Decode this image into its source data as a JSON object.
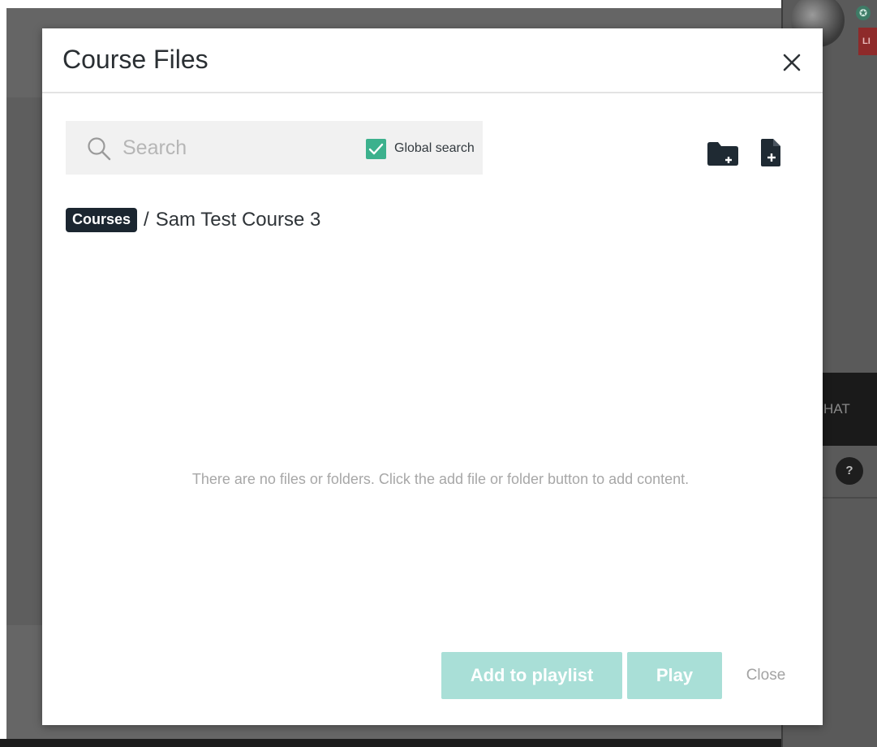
{
  "background": {
    "live_badge": "LI",
    "chat_tab": "HAT",
    "help_icon": "?"
  },
  "modal": {
    "title": "Course Files",
    "close_icon": "close-icon"
  },
  "search": {
    "placeholder": "Search",
    "value": "",
    "global_search_label": "Global search",
    "global_search_checked": true
  },
  "toolbar": {
    "new_folder_icon": "folder-plus-icon",
    "new_file_icon": "file-plus-icon"
  },
  "breadcrumb": {
    "root": "Courses",
    "separator": "/",
    "current": "Sam Test Course 3"
  },
  "empty_state": {
    "message": "There are no files or folders. Click the add file or folder button to add content."
  },
  "footer": {
    "add_to_playlist_label": "Add to playlist",
    "play_label": "Play",
    "close_label": "Close"
  },
  "colors": {
    "accent_teal": "#3cb18d",
    "button_disabled": "#a9dfd7",
    "breadcrumb_pill": "#1b2630",
    "overlay": "#5e5e5e"
  }
}
